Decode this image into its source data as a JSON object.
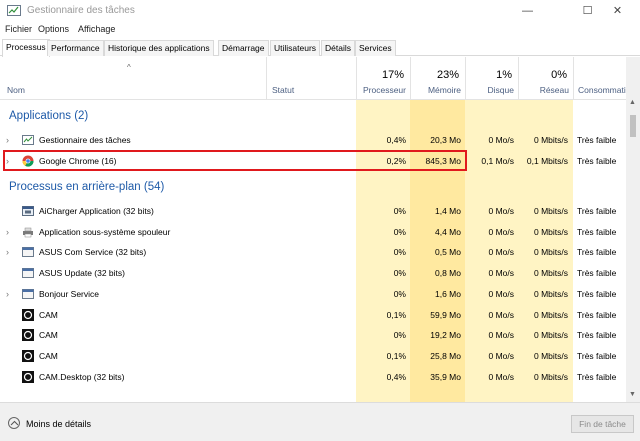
{
  "window": {
    "title": "Gestionnaire des tâches",
    "minimize_icon": "minimize-icon",
    "maximize_icon": "maximize-icon",
    "close_icon": "close-icon"
  },
  "menu": [
    "Fichier",
    "Options",
    "Affichage"
  ],
  "tabs": [
    "Processus",
    "Performance",
    "Historique des applications",
    "Démarrage",
    "Utilisateurs",
    "Détails",
    "Services"
  ],
  "active_tab": "Processus",
  "columns": {
    "name": "Nom",
    "status": "Statut",
    "cpu": {
      "pct": "17%",
      "label": "Processeur"
    },
    "mem": {
      "pct": "23%",
      "label": "Mémoire"
    },
    "disk": {
      "pct": "1%",
      "label": "Disque"
    },
    "net": {
      "pct": "0%",
      "label": "Réseau"
    },
    "power": "Consommatio..."
  },
  "groups": {
    "apps": "Applications (2)",
    "background": "Processus en arrière-plan (54)"
  },
  "apps": [
    {
      "name": "Gestionnaire des tâches",
      "cpu": "0,4%",
      "mem": "20,3 Mo",
      "disk": "0 Mo/s",
      "net": "0 Mbits/s",
      "power": "Très faible",
      "icon": "task-manager-icon"
    },
    {
      "name": "Google Chrome (16)",
      "cpu": "0,2%",
      "mem": "845,3 Mo",
      "disk": "0,1 Mo/s",
      "net": "0,1 Mbits/s",
      "power": "Très faible",
      "icon": "chrome-icon"
    }
  ],
  "background": [
    {
      "name": "AiCharger Application (32 bits)",
      "cpu": "0%",
      "mem": "1,4 Mo",
      "disk": "0 Mo/s",
      "net": "0 Mbits/s",
      "power": "Très faible",
      "icon": "aicharger-icon"
    },
    {
      "name": "Application sous-système spouleur",
      "cpu": "0%",
      "mem": "4,4 Mo",
      "disk": "0 Mo/s",
      "net": "0 Mbits/s",
      "power": "Très faible",
      "icon": "printer-icon"
    },
    {
      "name": "ASUS Com Service (32 bits)",
      "cpu": "0%",
      "mem": "0,5 Mo",
      "disk": "0 Mo/s",
      "net": "0 Mbits/s",
      "power": "Très faible",
      "icon": "service-window-icon"
    },
    {
      "name": "ASUS Update (32 bits)",
      "cpu": "0%",
      "mem": "0,8 Mo",
      "disk": "0 Mo/s",
      "net": "0 Mbits/s",
      "power": "Très faible",
      "icon": "service-window-icon"
    },
    {
      "name": "Bonjour Service",
      "cpu": "0%",
      "mem": "1,6 Mo",
      "disk": "0 Mo/s",
      "net": "0 Mbits/s",
      "power": "Très faible",
      "icon": "service-window-icon"
    },
    {
      "name": "CAM",
      "cpu": "0,1%",
      "mem": "59,9 Mo",
      "disk": "0 Mo/s",
      "net": "0 Mbits/s",
      "power": "Très faible",
      "icon": "cam-icon"
    },
    {
      "name": "CAM",
      "cpu": "0%",
      "mem": "19,2 Mo",
      "disk": "0 Mo/s",
      "net": "0 Mbits/s",
      "power": "Très faible",
      "icon": "cam-icon"
    },
    {
      "name": "CAM",
      "cpu": "0,1%",
      "mem": "25,8 Mo",
      "disk": "0 Mo/s",
      "net": "0 Mbits/s",
      "power": "Très faible",
      "icon": "cam-icon"
    },
    {
      "name": "CAM.Desktop (32 bits)",
      "cpu": "0,4%",
      "mem": "35,9 Mo",
      "disk": "0 Mo/s",
      "net": "0 Mbits/s",
      "power": "Très faible",
      "icon": "cam-icon"
    }
  ],
  "footer": {
    "less_details": "Moins de détails",
    "end_task": "Fin de tâche"
  },
  "colors": {
    "group_title": "#1e5aa8",
    "cpu_bg": "#fff4c4",
    "mem_bg": "#ffe9a0",
    "highlight_border": "#e0191d"
  }
}
